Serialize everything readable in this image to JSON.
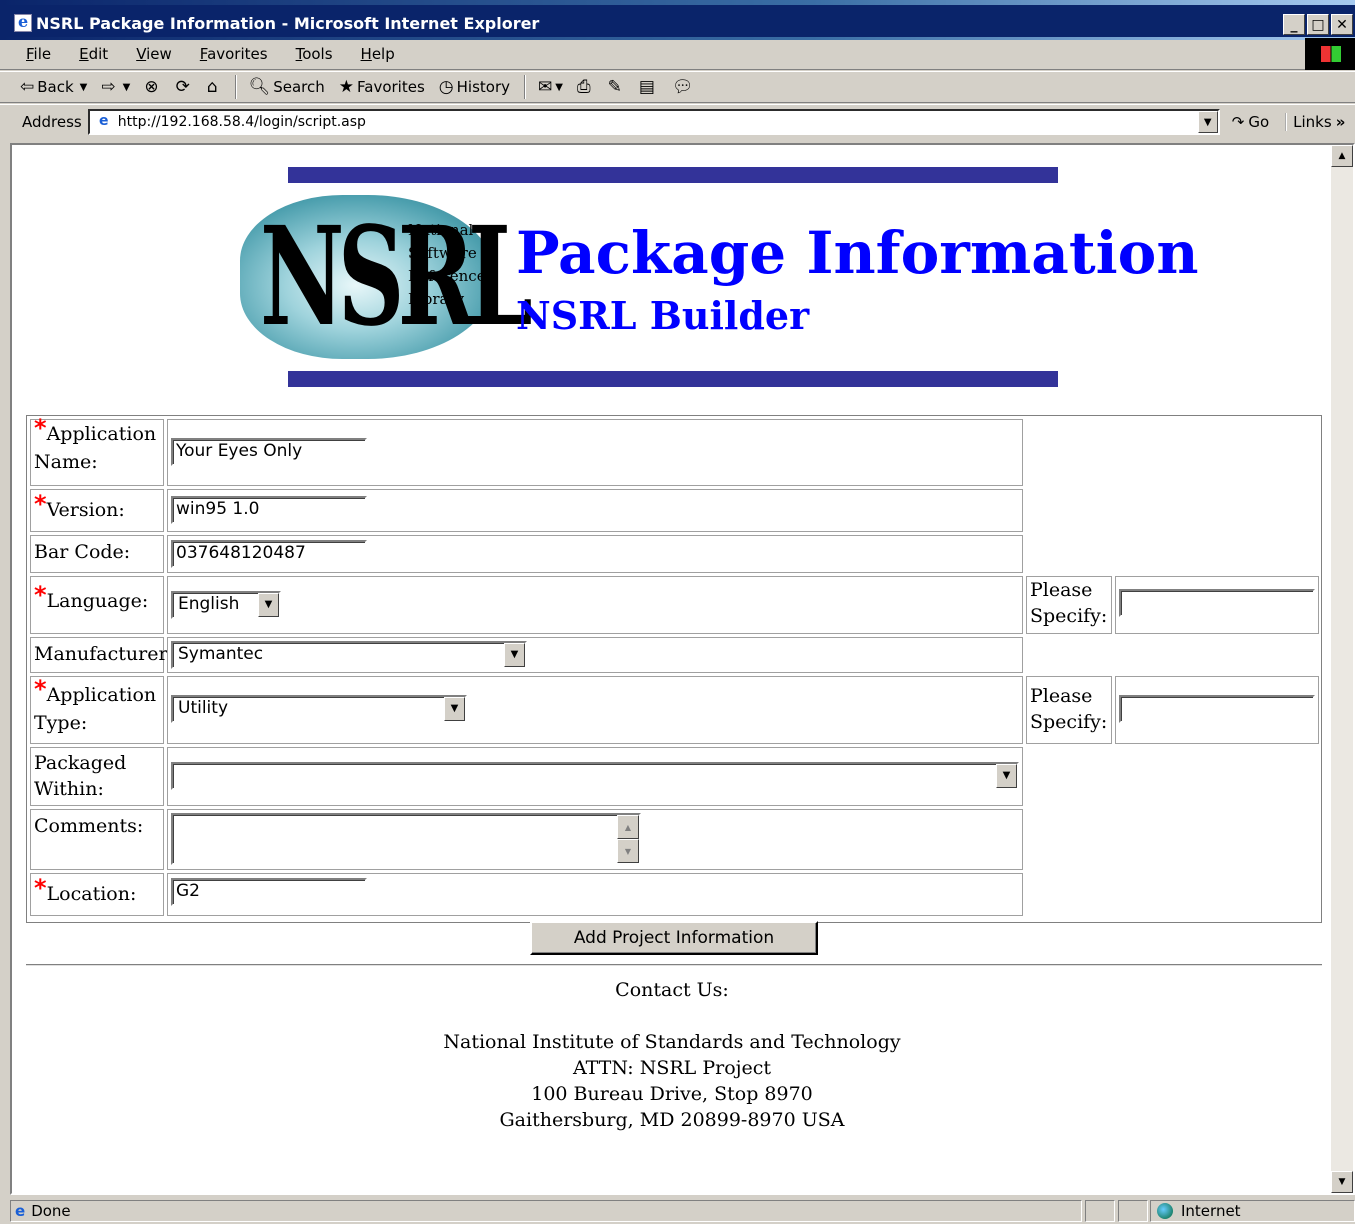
{
  "window": {
    "title": "NSRL Package Information - Microsoft Internet Explorer",
    "min": "_",
    "max": "□",
    "close": "✕"
  },
  "menu": [
    "File",
    "Edit",
    "View",
    "Favorites",
    "Tools",
    "Help"
  ],
  "toolbar": {
    "back": "Back",
    "search": "Search",
    "favorites": "Favorites",
    "history": "History"
  },
  "address": {
    "label": "Address",
    "url": "http://192.168.58.4/login/script.asp",
    "go": "Go",
    "links": "Links"
  },
  "header": {
    "title": "Package Information",
    "subtitle": "NSRL Builder",
    "logo_letters": "NSRL",
    "logo_words": [
      "National",
      "Software",
      "Reference",
      "Library"
    ]
  },
  "form": {
    "required_mark": "*",
    "app_name_label_1": "Application",
    "app_name_label_2": "Name:",
    "app_name_value": "Your Eyes Only",
    "version_label": "Version:",
    "version_value": "win95 1.0",
    "barcode_label": "Bar Code:",
    "barcode_value": "037648120487",
    "language_label": "Language:",
    "language_value": "English",
    "manufacturer_label": "Manufacturer:",
    "manufacturer_value": "Symantec",
    "app_type_label_1": "Application",
    "app_type_label_2": "Type:",
    "app_type_value": "Utility",
    "packaged_label_1": "Packaged",
    "packaged_label_2": "Within:",
    "packaged_value": "",
    "comments_label": "Comments:",
    "location_label": "Location:",
    "location_value": "G2",
    "please_specify_1": "Please",
    "please_specify_2": "Specify:",
    "submit_label": "Add Project Information"
  },
  "contact": {
    "heading": "Contact Us:",
    "lines": [
      "National Institute of Standards and Technology",
      "ATTN: NSRL Project",
      "100 Bureau Drive, Stop 8970",
      "Gaithersburg, MD 20899-8970 USA"
    ]
  },
  "status": {
    "text": "Done",
    "zone": "Internet"
  }
}
